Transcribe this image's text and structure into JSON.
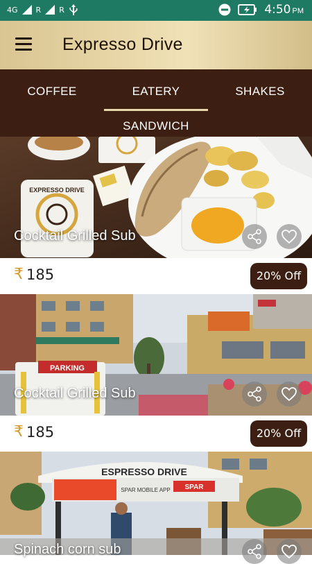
{
  "status_bar": {
    "network": "4G",
    "sim1": "R",
    "sim2": "R",
    "time": "4:50",
    "ampm": "PM"
  },
  "app_bar": {
    "title": "Expresso Drive"
  },
  "tabs": [
    {
      "label": "COFFEE"
    },
    {
      "label": "EATERY"
    },
    {
      "label": "SHAKES"
    },
    {
      "label": "SANDWICH"
    }
  ],
  "selected_tab": "EATERY",
  "colors": {
    "status_bar": "#1f7a63",
    "tab_bar": "#3d1e12",
    "app_bar": "#e8d7a8",
    "rupee": "#d19a2e"
  },
  "items": [
    {
      "title": "Cocktail Grilled Sub",
      "currency": "₹",
      "price": "185",
      "discount": "20% Off"
    },
    {
      "title": "Cocktail Grilled Sub",
      "currency": "₹",
      "price": "185",
      "discount": "20% Off"
    },
    {
      "title": "Spinach corn sub"
    }
  ],
  "image_text": {
    "coaster_logo": "EXPRESSO DRIVE",
    "parking_sign": "PARKING",
    "store_banner": "ESPRESSO DRIVE",
    "spar_banner": "SPAR MOBILE APP",
    "spar_sign": "SPAR"
  }
}
